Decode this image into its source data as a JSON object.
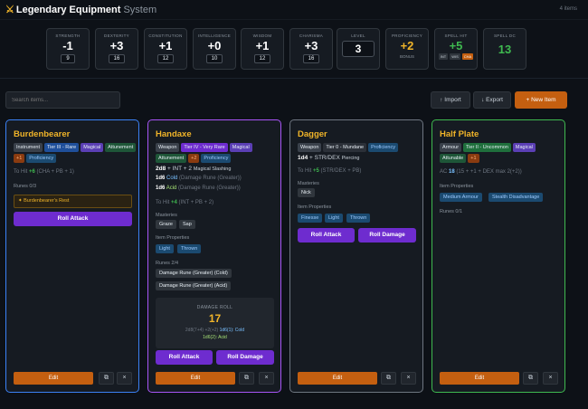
{
  "header": {
    "title": "Legendary Equipment",
    "subtitle": "System",
    "count": "4 items"
  },
  "stats": [
    {
      "label": "STRENGTH",
      "mod": "-1",
      "score": "9"
    },
    {
      "label": "DEXTERITY",
      "mod": "+3",
      "score": "16"
    },
    {
      "label": "CONSTITUTION",
      "mod": "+1",
      "score": "12"
    },
    {
      "label": "INTELLIGENCE",
      "mod": "+0",
      "score": "10"
    },
    {
      "label": "WISDOM",
      "mod": "+1",
      "score": "12"
    },
    {
      "label": "CHARISMA",
      "mod": "+3",
      "score": "16"
    }
  ],
  "level": {
    "label": "LEVEL",
    "value": "3"
  },
  "proficiency": {
    "label": "PROFICIENCY",
    "value": "+2",
    "sub": "BONUS"
  },
  "spell_hit": {
    "label": "SPELL HIT",
    "value": "+5",
    "opts": [
      "INT",
      "WIS",
      "CHA"
    ]
  },
  "spell_dc": {
    "label": "SPELL DC",
    "value": "13"
  },
  "toolbar": {
    "search_placeholder": "Search items...",
    "import": "↑ Import",
    "export": "↓ Export",
    "new_item": "+ New Item"
  },
  "colors": {
    "accent": "#c45f10",
    "gold": "#f0b429",
    "purple": "#6e2ccf",
    "card1": "#3b82f6",
    "card2": "#a855f7",
    "card3": "#6e7681",
    "card4": "#3fb950"
  },
  "cards": [
    {
      "title": "Burdenbearer",
      "tags": [
        "Instrument",
        "Tier III - Rare",
        "Magical",
        "Attunement",
        "+1",
        "Proficiency"
      ],
      "hit": {
        "label": "To Hit",
        "value": "+6",
        "detail": "(CHA + PB + 1)"
      },
      "runes": "Runes 0/3",
      "rune_slot": "✦ Burdenbearer's Rest",
      "roll_attack": "Roll Attack",
      "edit": "Edit"
    },
    {
      "title": "Handaxe",
      "tags": [
        "Weapon",
        "Tier IV - Very Rare",
        "Magical",
        "Attunement",
        "+2",
        "Proficiency"
      ],
      "dmg1": {
        "dice": "2d8",
        "mod": "+ INT + 2",
        "type": "Magical Slashing"
      },
      "dmg2": {
        "dice": "1d6",
        "type": "Cold",
        "note": "(Damage Rune (Greater))"
      },
      "dmg3": {
        "dice": "1d6",
        "type": "Acid",
        "note": "(Damage Rune (Greater))"
      },
      "hit": {
        "label": "To Hit",
        "value": "+4",
        "detail": "(INT + PB + 2)"
      },
      "masteries_label": "Masteries",
      "masteries": [
        "Graze",
        "Sap"
      ],
      "props_label": "Item Properties",
      "props": [
        "Light",
        "Thrown"
      ],
      "runes": "Runes 2/4",
      "rune_list": [
        "Damage Rune (Greater) (Cold)",
        "Damage Rune (Greater) (Acid)"
      ],
      "roll": {
        "label": "DAMAGE ROLL",
        "value": "17",
        "d1": "2d8(7+4)",
        "d2": "+2(+2)",
        "d3": "1d6(1): Cold",
        "d4": "1d6(2): Acid"
      },
      "roll_attack": "Roll Attack",
      "roll_damage": "Roll Damage",
      "edit": "Edit"
    },
    {
      "title": "Dagger",
      "tags": [
        "Weapon",
        "Tier 0 - Mundane",
        "Proficiency"
      ],
      "dmg1": {
        "dice": "1d4",
        "mod": "+ STR/DEX",
        "type": "Piercing"
      },
      "hit": {
        "label": "To Hit",
        "value": "+5",
        "detail": "(STR/DEX + PB)"
      },
      "masteries_label": "Masteries",
      "masteries": [
        "Nick"
      ],
      "props_label": "Item Properties",
      "props": [
        "Finesse",
        "Light",
        "Thrown"
      ],
      "roll_attack": "Roll Attack",
      "roll_damage": "Roll Damage",
      "edit": "Edit"
    },
    {
      "title": "Half Plate",
      "tags": [
        "Armour",
        "Tier II - Uncommon",
        "Magical",
        "Attunable",
        "+1"
      ],
      "ac": {
        "label": "AC",
        "value": "18",
        "detail": "(15 + +1 + DEX max 2(+2))"
      },
      "props_label": "Item Properties",
      "props": [
        "Medium Armour",
        "Stealth Disadvantage"
      ],
      "runes": "Runes 0/1",
      "edit": "Edit"
    }
  ]
}
